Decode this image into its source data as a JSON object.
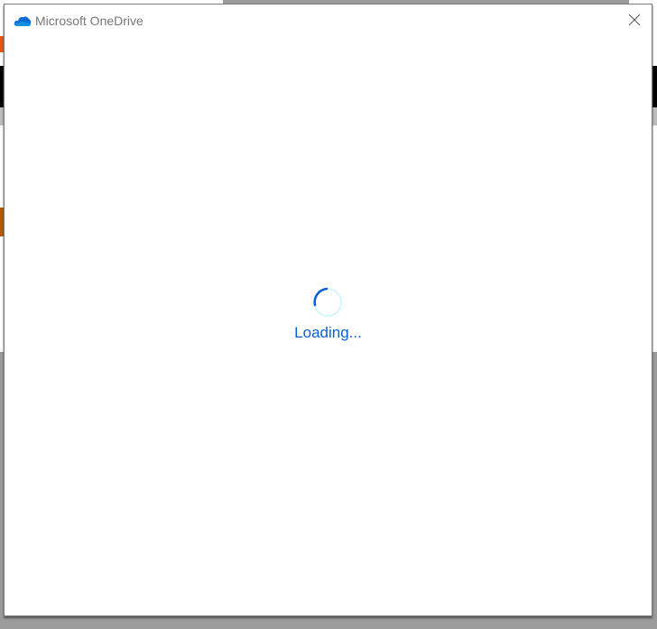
{
  "dialog": {
    "title": "Microsoft OneDrive",
    "icon": "onedrive-cloud-icon",
    "close_icon": "close-icon",
    "loading_text": "Loading...",
    "accent_color": "#0a5fd6"
  }
}
